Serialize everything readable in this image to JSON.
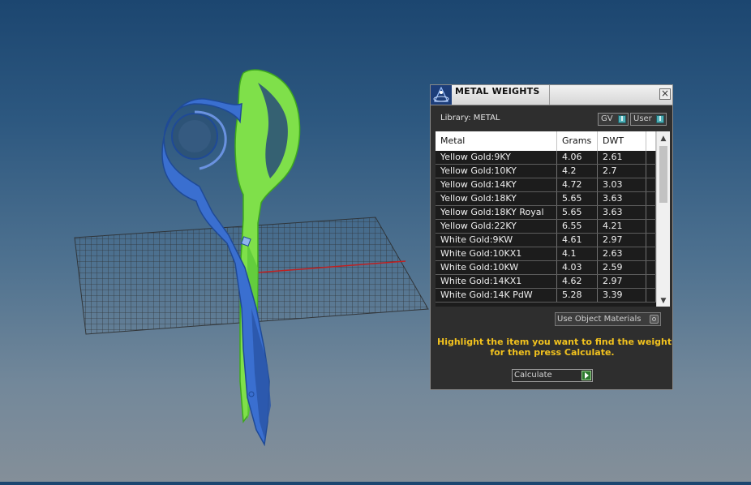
{
  "viewport": {
    "scene": "3D jewelry viewport: scissors model on ground grid"
  },
  "panel": {
    "title": "METAL WEIGHTS",
    "library_label": "Library: METAL",
    "toggles": {
      "gv_label": "GV",
      "user_label": "User",
      "indicator": "I"
    },
    "close_icon_glyph": "×",
    "table": {
      "columns": [
        "Metal",
        "Grams",
        "DWT"
      ],
      "rows": [
        [
          "Yellow Gold:9KY",
          "4.06",
          "2.61"
        ],
        [
          "Yellow Gold:10KY",
          "4.2",
          "2.7"
        ],
        [
          "Yellow Gold:14KY",
          "4.72",
          "3.03"
        ],
        [
          "Yellow Gold:18KY",
          "5.65",
          "3.63"
        ],
        [
          "Yellow Gold:18KY Royal",
          "5.65",
          "3.63"
        ],
        [
          "Yellow Gold:22KY",
          "6.55",
          "4.21"
        ],
        [
          "White Gold:9KW",
          "4.61",
          "2.97"
        ],
        [
          "White Gold:10KX1",
          "4.1",
          "2.63"
        ],
        [
          "White Gold:10KW",
          "4.03",
          "2.59"
        ],
        [
          "White Gold:14KX1",
          "4.62",
          "2.97"
        ],
        [
          "White Gold:14K PdW",
          "5.28",
          "3.39"
        ]
      ],
      "scroll_up_glyph": "▲",
      "scroll_down_glyph": "▼"
    },
    "use_object_materials_label": "Use Object Materials",
    "instructions_line1": "Highlight the item you want to find the weight",
    "instructions_line2": "for then press Calculate.",
    "calculate_label": "Calculate",
    "colors": {
      "panel_bg": "#2e2e2e",
      "instruction_text": "#f2c21e",
      "model_blue": "#3a6fd0",
      "model_green": "#7fe04a",
      "axis_red": "#c02020"
    }
  }
}
